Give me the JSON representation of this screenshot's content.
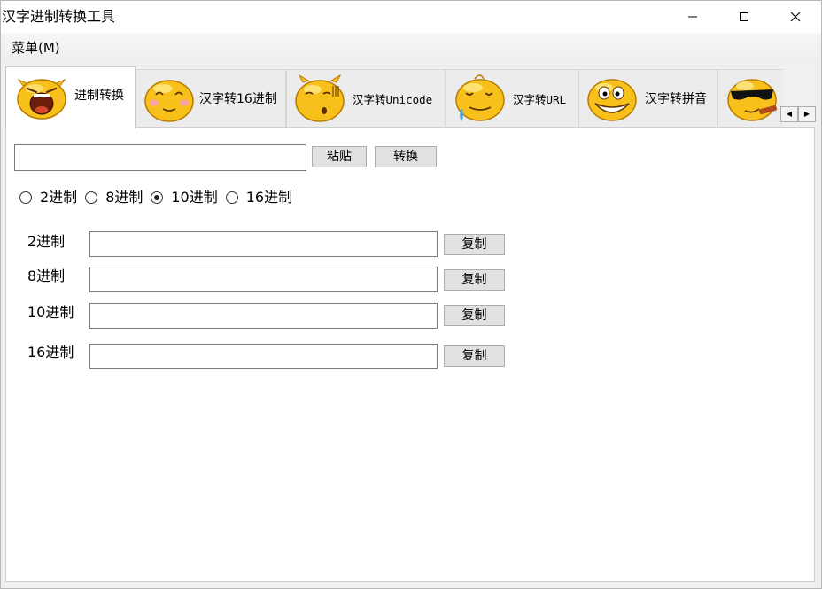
{
  "window": {
    "title": "汉字进制转换工具",
    "minimize_icon": "minimize-icon",
    "maximize_icon": "maximize-icon",
    "close_icon": "close-icon"
  },
  "menu": {
    "label": "菜单(M)"
  },
  "tabs": [
    {
      "label": "进制转换",
      "icon": "angry-face-icon",
      "active": true
    },
    {
      "label": "汉字转16进制",
      "icon": "blushing-face-icon",
      "active": false
    },
    {
      "label": "汉字转Unicode",
      "icon": "confused-face-icon",
      "active": false
    },
    {
      "label": "汉字转URL",
      "icon": "drooling-face-icon",
      "active": false
    },
    {
      "label": "汉字转拼音",
      "icon": "grinning-face-icon",
      "active": false
    },
    {
      "label": "",
      "icon": "cool-face-icon",
      "active": false
    }
  ],
  "tab_scroll": {
    "left_icon": "scroll-left-icon",
    "right_icon": "scroll-right-icon"
  },
  "input_row": {
    "value": "",
    "paste_label": "粘贴",
    "convert_label": "转换"
  },
  "radix_options": [
    {
      "label": "2进制",
      "checked": false
    },
    {
      "label": "8进制",
      "checked": false
    },
    {
      "label": "10进制",
      "checked": true
    },
    {
      "label": "16进制",
      "checked": false
    }
  ],
  "results": [
    {
      "label": "2进制",
      "value": "",
      "copy_label": "复制"
    },
    {
      "label": "8进制",
      "value": "",
      "copy_label": "复制"
    },
    {
      "label": "10进制",
      "value": "",
      "copy_label": "复制"
    },
    {
      "label": "16进制",
      "value": "",
      "copy_label": "复制"
    }
  ],
  "colors": {
    "face_yellow": "#f7c01b",
    "face_outline": "#b87b00",
    "face_highlight": "#ffe98a"
  }
}
